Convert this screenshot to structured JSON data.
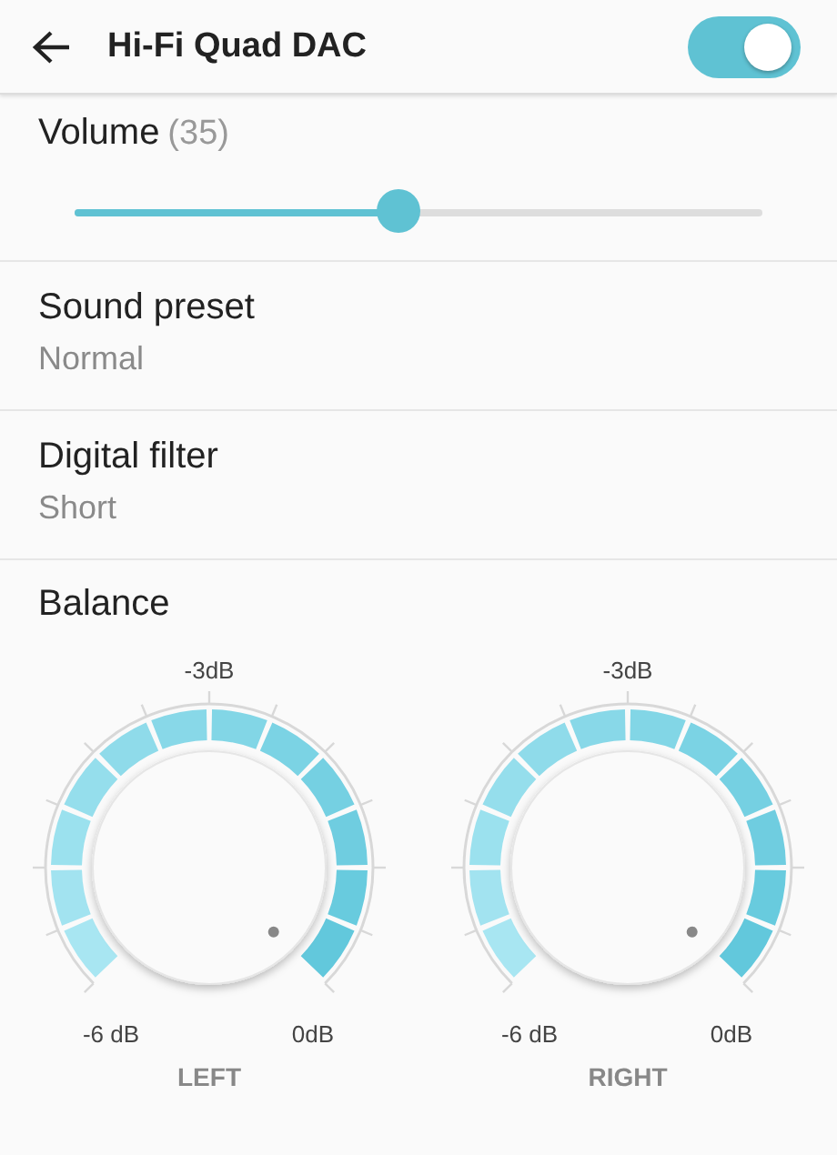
{
  "header": {
    "title": "Hi-Fi Quad DAC",
    "on": true
  },
  "volume": {
    "label": "Volume",
    "value": "(35)",
    "level": 0.47
  },
  "settings": [
    {
      "title": "Sound preset",
      "value": "Normal"
    },
    {
      "title": "Digital filter",
      "value": "Short"
    }
  ],
  "balance": {
    "title": "Balance",
    "dials": [
      {
        "top_label": "-3dB",
        "min_label": "-6 dB",
        "max_label": "0dB",
        "channel": "LEFT"
      },
      {
        "top_label": "-3dB",
        "min_label": "-6 dB",
        "max_label": "0dB",
        "channel": "RIGHT"
      }
    ]
  }
}
